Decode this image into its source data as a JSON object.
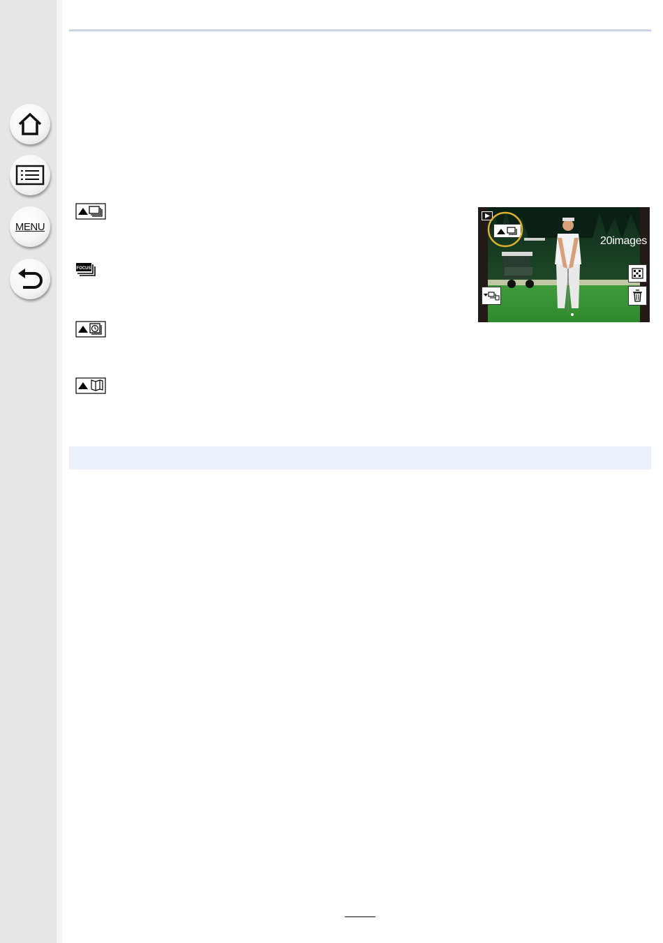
{
  "navigation": {
    "home_label": "",
    "contents_label": "",
    "menu_label": "MENU",
    "back_label": ""
  },
  "group_icons": [
    {
      "name": "burst-group-icon"
    },
    {
      "name": "focus-stacking-group-icon"
    },
    {
      "name": "time-lapse-group-icon"
    },
    {
      "name": "stop-motion-group-icon"
    }
  ],
  "illustration": {
    "image_count": "20images",
    "highlight_color": "#e0b030"
  },
  "page": {
    "number": ""
  },
  "colors": {
    "sidebar": "#e6e6e6",
    "rule": "#c9d4e6",
    "section_bar": "#eaf1fb"
  }
}
